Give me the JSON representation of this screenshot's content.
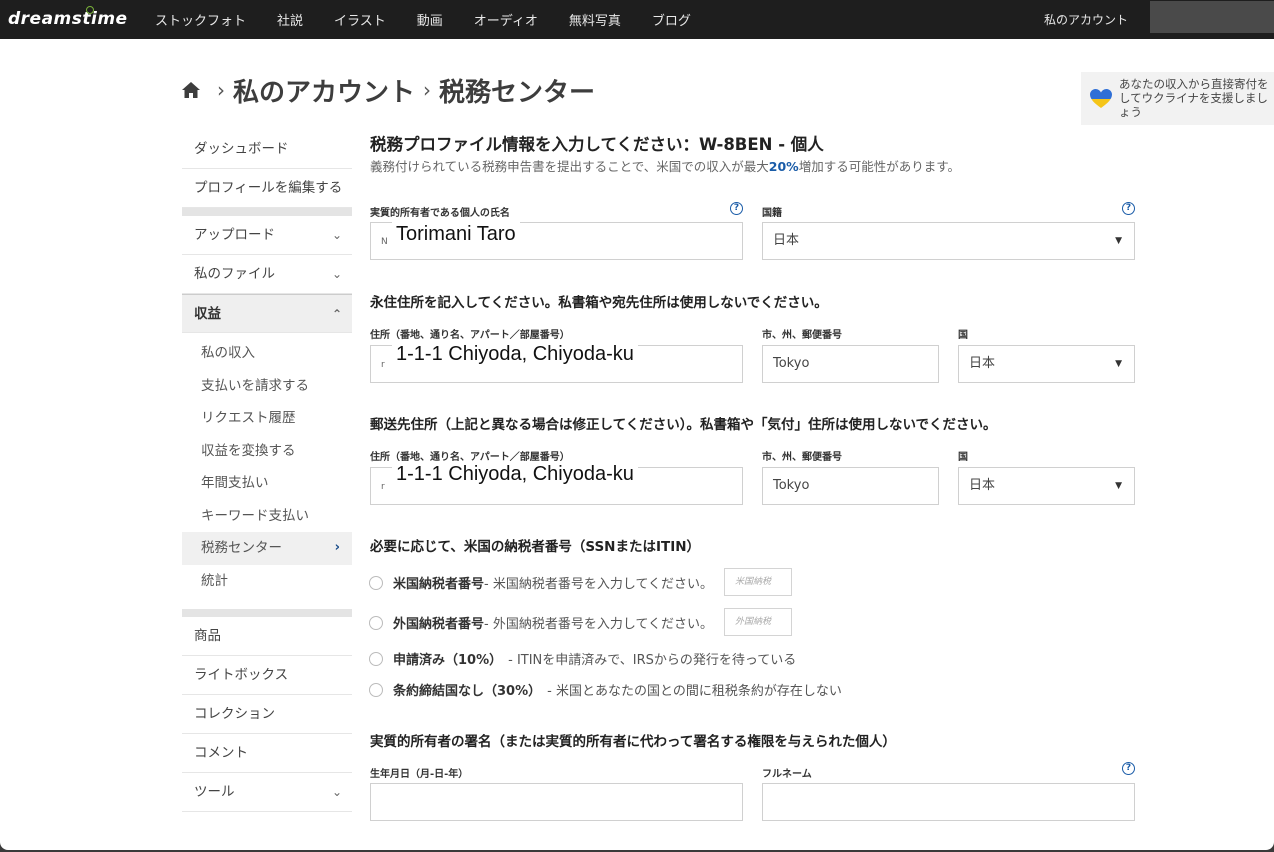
{
  "nav": {
    "logo": "dreamstime",
    "items": [
      "ストックフォト",
      "社説",
      "イラスト",
      "動画",
      "オーディオ",
      "無料写真",
      "ブログ"
    ],
    "account": "私のアカウント"
  },
  "breadcrumb": {
    "items": [
      "私のアカウント",
      "税務センター"
    ],
    "sep": "›"
  },
  "ukraine": {
    "text": "あなたの収入から直接寄付をしてウクライナを支援しましょう"
  },
  "sidebar": {
    "items": [
      "ダッシュボード",
      "プロフィールを編集する",
      "アップロード",
      "私のファイル",
      "収益"
    ],
    "sub_items": [
      "私の収入",
      "支払いを請求する",
      "リクエスト履歴",
      "収益を変換する",
      "年間支払い",
      "キーワード支払い",
      "税務センター",
      "統計"
    ],
    "items2": [
      "商品",
      "ライトボックス",
      "コレクション",
      "コメント",
      "ツール"
    ]
  },
  "form": {
    "title": "税務プロファイル情報を入力してください：W-8BEN - 個人",
    "subtitle_pre": "義務付けられている税務申告書を提出することで、米国での収入が最大",
    "subtitle_hl": "20%",
    "subtitle_post": "増加する可能性があります。",
    "name_label": "実質的所有者である個人の氏名",
    "name_value": "Torimani Taro",
    "name_field_prefix": "N",
    "nationality_label": "国籍",
    "nationality_value": "日本",
    "perm_section": "永住住所を記入してください。私書箱や宛先住所は使用しないでください。",
    "address_label": "住所（番地、通り名、アパート／部屋番号）",
    "city_label": "市、州、郵便番号",
    "country_label": "国",
    "perm_address": "1-1-1 Chiyoda, Chiyoda-ku",
    "perm_field_prefix": "r",
    "perm_city": "Tokyo",
    "perm_country": "日本",
    "mail_section": "郵送先住所（上記と異なる場合は修正してください）。私書箱や「気付」住所は使用しないでください。",
    "mail_address": "1-1-1 Chiyoda, Chiyoda-ku",
    "mail_field_prefix": "r",
    "mail_city": "Tokyo",
    "mail_country": "日本",
    "tin_section": "必要に応じて、米国の納税者番号（SSNまたはITIN）",
    "opt1_bold": "米国納税者番号",
    "opt1_text": "- 米国納税者番号を入力してください。",
    "opt1_placeholder": "米国納税",
    "opt2_bold": "外国納税者番号",
    "opt2_text": "- 外国納税者番号を入力してください。",
    "opt2_placeholder": "外国納税",
    "opt3_bold": "申請済み（10%）",
    "opt3_text": "- ITINを申請済みで、IRSからの発行を待っている",
    "opt4_bold": "条約締結国なし（30%）",
    "opt4_text": "- 米国とあなたの国との間に租税条約が存在しない",
    "sig_section": "実質的所有者の署名（または実質的所有者に代わって署名する権限を与えられた個人）",
    "dob_label": "生年月日（月-日-年）",
    "fullname_label": "フルネーム"
  },
  "colors": {
    "nav_bg": "#1e1e1e",
    "link": "#1a5ca8",
    "ukraine_blue": "#2f6fd6",
    "ukraine_yellow": "#f5c518"
  }
}
